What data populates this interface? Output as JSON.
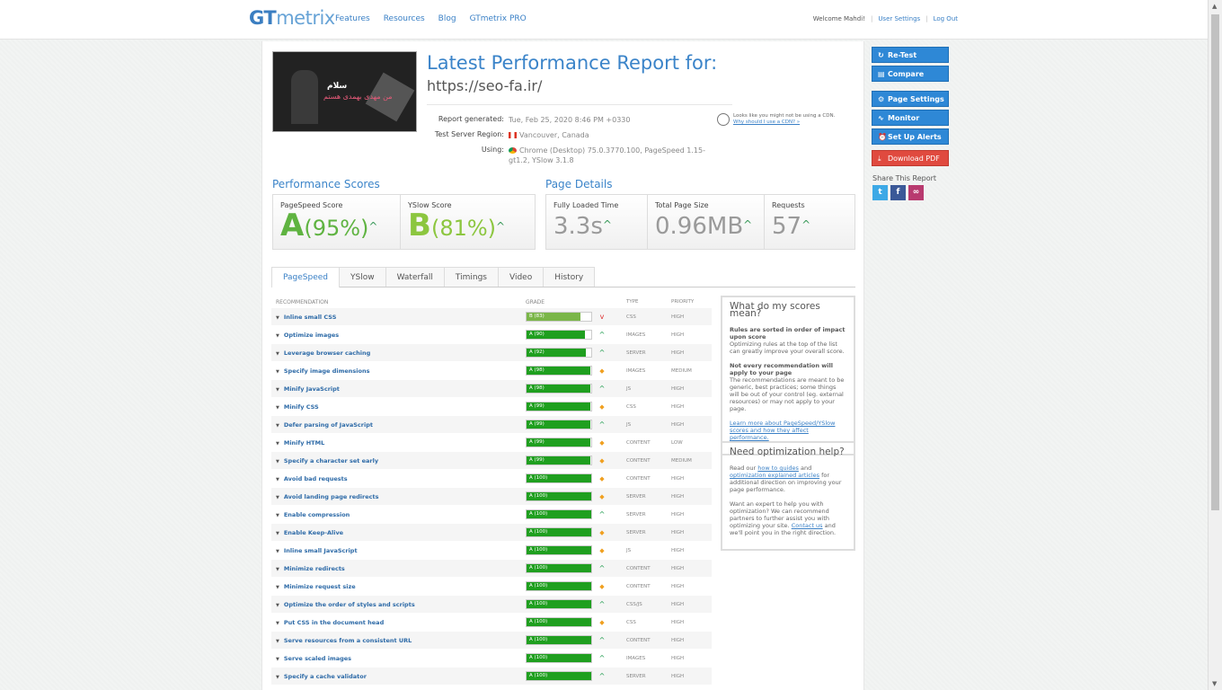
{
  "header": {
    "logo_gt": "GT",
    "logo_metrix": "metrix",
    "nav": [
      "Features",
      "Resources",
      "Blog",
      "GTmetrix PRO"
    ],
    "welcome": "Welcome Mahdi!",
    "user_settings": "User Settings",
    "logout": "Log Out"
  },
  "thumb": {
    "title": "سلام",
    "subtitle": "من مهدی بهمدی هستم"
  },
  "report": {
    "title": "Latest Performance Report for:",
    "url": "https://seo-fa.ir/",
    "generated_label": "Report generated:",
    "generated_value": "Tue, Feb 25, 2020 8:46 PM +0330",
    "region_label": "Test Server Region:",
    "region_value": "Vancouver, Canada",
    "using_label": "Using:",
    "using_value": "Chrome (Desktop) 75.0.3770.100, PageSpeed 1.15-gt1.2, YSlow 3.1.8",
    "cdn_text": "Looks like you might not be using a CDN.",
    "cdn_link": "Why should I use a CDN? »"
  },
  "scores": {
    "heading": "Performance Scores",
    "pagespeed_label": "PageSpeed Score",
    "pagespeed_grade": "A",
    "pagespeed_pct": "(95%)",
    "yslow_label": "YSlow Score",
    "yslow_grade": "B",
    "yslow_pct": "(81%)"
  },
  "details": {
    "heading": "Page Details",
    "load_label": "Fully Loaded Time",
    "load_value": "3.3s",
    "size_label": "Total Page Size",
    "size_value": "0.96MB",
    "req_label": "Requests",
    "req_value": "57"
  },
  "tabs": [
    "PageSpeed",
    "YSlow",
    "Waterfall",
    "Timings",
    "Video",
    "History"
  ],
  "table": {
    "headers": [
      "RECOMMENDATION",
      "GRADE",
      "TYPE",
      "PRIORITY"
    ],
    "rows": [
      {
        "name": "Inline small CSS",
        "grade": "B (83)",
        "pct": 83,
        "type": "CSS",
        "priority": "HIGH",
        "ind": "dn"
      },
      {
        "name": "Optimize images",
        "grade": "A (90)",
        "pct": 90,
        "type": "IMAGES",
        "priority": "HIGH",
        "ind": "up"
      },
      {
        "name": "Leverage browser caching",
        "grade": "A (92)",
        "pct": 92,
        "type": "SERVER",
        "priority": "HIGH",
        "ind": "up"
      },
      {
        "name": "Specify image dimensions",
        "grade": "A (98)",
        "pct": 98,
        "type": "IMAGES",
        "priority": "MEDIUM",
        "ind": "dia"
      },
      {
        "name": "Minify JavaScript",
        "grade": "A (98)",
        "pct": 98,
        "type": "JS",
        "priority": "HIGH",
        "ind": "up"
      },
      {
        "name": "Minify CSS",
        "grade": "A (99)",
        "pct": 99,
        "type": "CSS",
        "priority": "HIGH",
        "ind": "dia"
      },
      {
        "name": "Defer parsing of JavaScript",
        "grade": "A (99)",
        "pct": 99,
        "type": "JS",
        "priority": "HIGH",
        "ind": "up"
      },
      {
        "name": "Minify HTML",
        "grade": "A (99)",
        "pct": 99,
        "type": "CONTENT",
        "priority": "LOW",
        "ind": "dia"
      },
      {
        "name": "Specify a character set early",
        "grade": "A (99)",
        "pct": 99,
        "type": "CONTENT",
        "priority": "MEDIUM",
        "ind": "dia"
      },
      {
        "name": "Avoid bad requests",
        "grade": "A (100)",
        "pct": 100,
        "type": "CONTENT",
        "priority": "HIGH",
        "ind": "dia"
      },
      {
        "name": "Avoid landing page redirects",
        "grade": "A (100)",
        "pct": 100,
        "type": "SERVER",
        "priority": "HIGH",
        "ind": "dia"
      },
      {
        "name": "Enable compression",
        "grade": "A (100)",
        "pct": 100,
        "type": "SERVER",
        "priority": "HIGH",
        "ind": "up"
      },
      {
        "name": "Enable Keep-Alive",
        "grade": "A (100)",
        "pct": 100,
        "type": "SERVER",
        "priority": "HIGH",
        "ind": "dia"
      },
      {
        "name": "Inline small JavaScript",
        "grade": "A (100)",
        "pct": 100,
        "type": "JS",
        "priority": "HIGH",
        "ind": "dia"
      },
      {
        "name": "Minimize redirects",
        "grade": "A (100)",
        "pct": 100,
        "type": "CONTENT",
        "priority": "HIGH",
        "ind": "up"
      },
      {
        "name": "Minimize request size",
        "grade": "A (100)",
        "pct": 100,
        "type": "CONTENT",
        "priority": "HIGH",
        "ind": "dia"
      },
      {
        "name": "Optimize the order of styles and scripts",
        "grade": "A (100)",
        "pct": 100,
        "type": "CSS/JS",
        "priority": "HIGH",
        "ind": "up"
      },
      {
        "name": "Put CSS in the document head",
        "grade": "A (100)",
        "pct": 100,
        "type": "CSS",
        "priority": "HIGH",
        "ind": "dia"
      },
      {
        "name": "Serve resources from a consistent URL",
        "grade": "A (100)",
        "pct": 100,
        "type": "CONTENT",
        "priority": "HIGH",
        "ind": "up"
      },
      {
        "name": "Serve scaled images",
        "grade": "A (100)",
        "pct": 100,
        "type": "IMAGES",
        "priority": "HIGH",
        "ind": "up"
      },
      {
        "name": "Specify a cache validator",
        "grade": "A (100)",
        "pct": 100,
        "type": "SERVER",
        "priority": "HIGH",
        "ind": "up"
      }
    ]
  },
  "sidebox1": {
    "title": "What do my scores mean?",
    "b1": "Rules are sorted in order of impact upon score",
    "t1": "Optimizing rules at the top of the list can greatly improve your overall score.",
    "b2": "Not every recommendation will apply to your page",
    "t2": "The recommendations are meant to be generic, best practices; some things will be out of your control (eg. external resources) or may not apply to your page.",
    "link": "Learn more about PageSpeed/YSlow scores and how they affect performance."
  },
  "sidebox2": {
    "title": "Need optimization help?",
    "p1a": "Read our",
    "p1l1": "how to guides",
    "p1b": "and",
    "p1l2": "optimization explained articles",
    "p1c": "for additional direction on improving your page performance.",
    "p2a": "Want an expert to help you with optimization? We can recommend partners to further assist you with optimizing your site.",
    "p2l": "Contact us",
    "p2b": "and we'll point you in the right direction."
  },
  "actions": {
    "retest": "Re-Test",
    "compare": "Compare",
    "page_settings": "Page Settings",
    "monitor": "Monitor",
    "alerts": "Set Up Alerts",
    "pdf": "Download PDF",
    "share": "Share This Report"
  },
  "colors": {
    "accent": "#3b84c9",
    "grade_green": "#1f9f1f",
    "pdf_red": "#e04a3f"
  }
}
